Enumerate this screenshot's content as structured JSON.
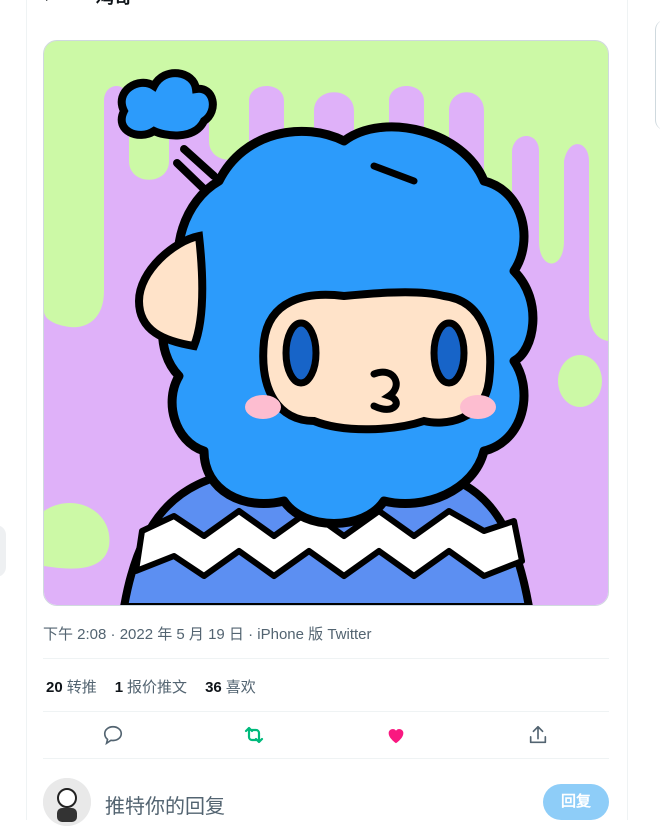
{
  "header": {
    "back_icon": "arrow-left-icon",
    "title": "鸡哥"
  },
  "tweet": {
    "media_description": "cartoon avatar: blue curly-haired character with sweater on purple and green slime background",
    "timestamp": "下午 2:08 · 2022 年 5 月 19 日",
    "separator": " · ",
    "source": "iPhone 版 Twitter"
  },
  "stats": [
    {
      "count": "20",
      "label": "转推"
    },
    {
      "count": "1",
      "label": "报价推文"
    },
    {
      "count": "36",
      "label": "喜欢"
    }
  ],
  "actions": {
    "reply_icon": "comment-icon",
    "retweet_icon": "retweet-icon",
    "like_icon": "heart-icon",
    "share_icon": "share-icon",
    "retweet_color": "#00ba7c",
    "like_color": "#f91880"
  },
  "reply": {
    "placeholder": "推特你的回复",
    "button": "回复"
  }
}
